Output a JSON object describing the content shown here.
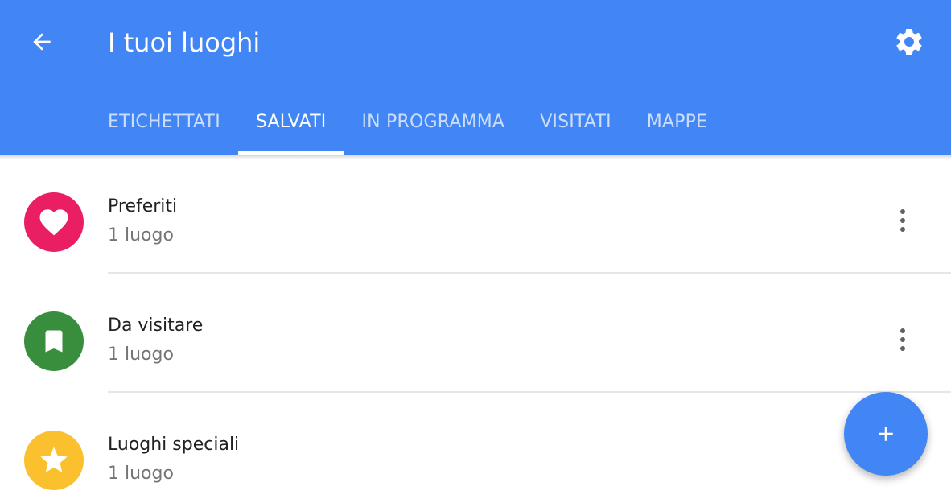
{
  "header": {
    "title": "I tuoi luoghi",
    "back_icon": "arrow-back-icon",
    "settings_icon": "gear-icon"
  },
  "tabs": [
    {
      "label": "ETICHETTATI",
      "active": false
    },
    {
      "label": "SALVATI",
      "active": true
    },
    {
      "label": "IN PROGRAMMA",
      "active": false
    },
    {
      "label": "VISITATI",
      "active": false
    },
    {
      "label": "MAPPE",
      "active": false
    }
  ],
  "lists": [
    {
      "title": "Preferiti",
      "subtitle": "1 luogo",
      "icon": "heart-icon",
      "color": "#ea1e63"
    },
    {
      "title": "Da visitare",
      "subtitle": "1 luogo",
      "icon": "bookmark-icon",
      "color": "#388e3c"
    },
    {
      "title": "Luoghi speciali",
      "subtitle": "1 luogo",
      "icon": "star-icon",
      "color": "#fbc02d"
    }
  ],
  "fab": {
    "icon": "plus-icon"
  },
  "colors": {
    "header": "#4285f4",
    "fab": "#4285f4"
  }
}
